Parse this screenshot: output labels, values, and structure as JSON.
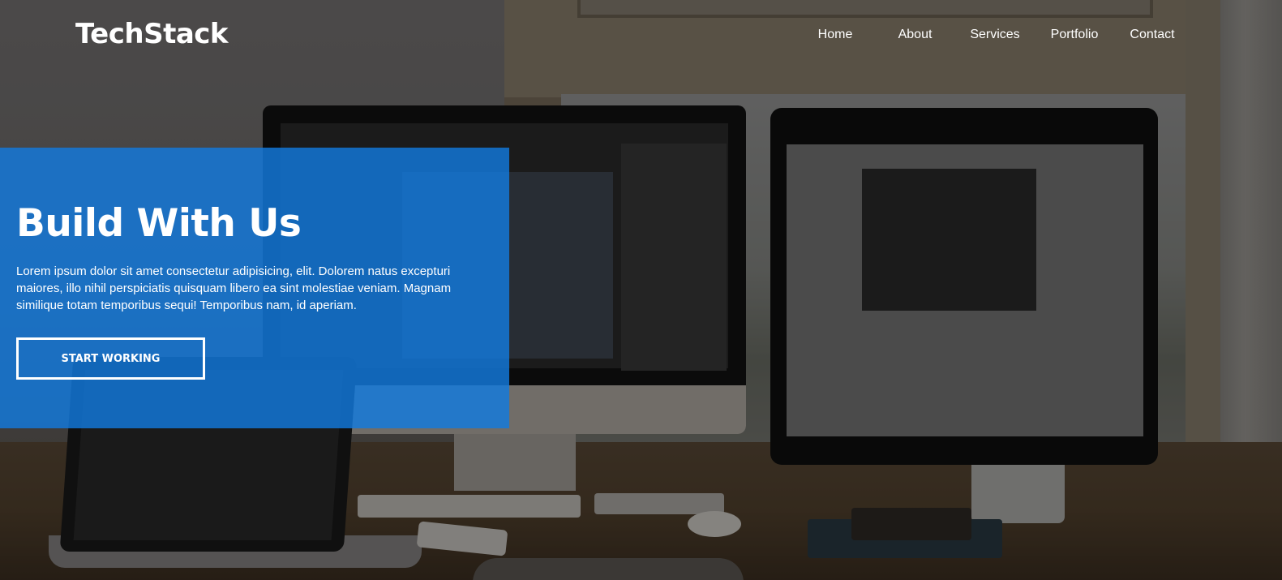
{
  "header": {
    "logo": "TechStack",
    "nav": [
      {
        "label": "Home"
      },
      {
        "label": "About"
      },
      {
        "label": "Services"
      },
      {
        "label": "Portfolio"
      },
      {
        "label": "Contact"
      }
    ]
  },
  "hero": {
    "title": "Build With Us",
    "description": "Lorem ipsum dolor sit amet consectetur adipisicing, elit. Dolorem natus excepturi maiores, illo nihil perspiciatis quisquam libero ea sint molestiae veniam. Magnam similique totam temporibus sequi! Temporibus nam, id aperiam.",
    "cta_label": "START WORKING"
  },
  "colors": {
    "hero_overlay": "#127ade",
    "text": "#ffffff"
  }
}
